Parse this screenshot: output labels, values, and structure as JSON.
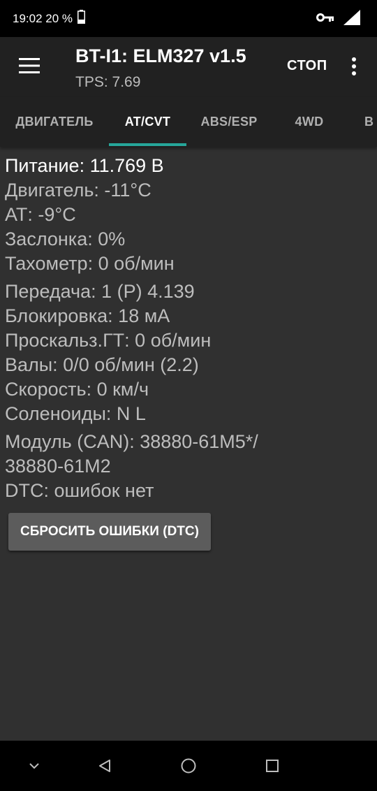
{
  "status_bar": {
    "time_battery": "19:02 20 %",
    "icons": [
      "battery-icon",
      "key-icon",
      "signal-icon"
    ]
  },
  "toolbar": {
    "title": "BT-I1: ELM327 v1.5",
    "subtitle": "TPS: 7.69",
    "stop_label": "СТОП",
    "icons": [
      "menu-icon",
      "overflow-menu-icon"
    ]
  },
  "tabs": [
    {
      "label": "ДВИГАТЕЛЬ"
    },
    {
      "label": "AT/CVT"
    },
    {
      "label": "ABS/ESP"
    },
    {
      "label": "4WD"
    },
    {
      "label": "В"
    }
  ],
  "active_tab": "AT/CVT",
  "readings": {
    "power": "Питание: 11.769 В",
    "engine": "Двигатель: -11°C",
    "at": "АТ: -9°C",
    "throttle": "Заслонка: 0%",
    "tachometer": "Тахометр: 0 об/мин",
    "gear": "Передача: 1 (P) 4.139",
    "lockup": "Блокировка: 18 мА",
    "slip": "Проскальз.ГТ: 0 об/мин",
    "shafts": "Валы: 0/0 об/мин (2.2)",
    "speed": "Скорость: 0 км/ч",
    "solenoids": "Соленоиды: N L",
    "module_line1": "Модуль (CAN): 38880-61M5*/",
    "module_line2": "38880-61M2",
    "dtc": "DTC: ошибок нет"
  },
  "reset_button_label": "СБРОСИТЬ ОШИБКИ (DTC)",
  "nav_bar": {
    "icons": [
      "collapse-chevron-icon",
      "back-icon",
      "home-icon",
      "recents-icon"
    ]
  },
  "colors": {
    "background": "#303030",
    "toolbar": "#212121",
    "accent": "#26a69a",
    "button": "#5c5c5c"
  }
}
